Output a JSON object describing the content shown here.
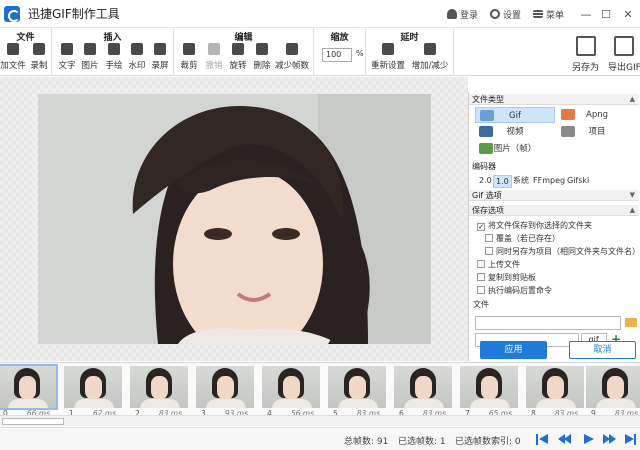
{
  "app": {
    "title": "迅捷GIF制作工具",
    "brand_color": "#1f7ad8"
  },
  "titlebar": {
    "login": "登录",
    "settings": "设置",
    "menu": "菜单",
    "minimize": "—",
    "maximize": "☐",
    "close": "✕"
  },
  "ribbon": {
    "file": {
      "title": "文件",
      "tools": [
        "加文件",
        "录制"
      ]
    },
    "insert": {
      "title": "插入",
      "tools": [
        "文字",
        "图片",
        "手绘",
        "水印",
        "录屏"
      ]
    },
    "edit": {
      "title": "编辑",
      "tools": [
        "裁剪",
        "撤销",
        "旋转",
        "删除",
        "减少帧数"
      ]
    },
    "zoom": {
      "title": "缩放",
      "value": "100",
      "unit": "%"
    },
    "delay": {
      "title": "延时",
      "tools": [
        "重新设置",
        "增加/减少"
      ]
    },
    "save_as": "另存为",
    "export_gif": "导出GIF"
  },
  "panel": {
    "file_type_header": "文件类型",
    "file_types": [
      {
        "label": "Gif",
        "selected": true
      },
      {
        "label": "Apng",
        "selected": false
      },
      {
        "label": "视频",
        "selected": false
      },
      {
        "label": "项目",
        "selected": false
      },
      {
        "label": "图片（帧）",
        "selected": false
      }
    ],
    "encoder_header": "编码器",
    "encoders": [
      {
        "label": "2.0",
        "selected": false
      },
      {
        "label": "1.0",
        "selected": true
      },
      {
        "label": "系统",
        "selected": false
      },
      {
        "label": "FFmpeg",
        "selected": false
      },
      {
        "label": "Gifski",
        "selected": false
      }
    ],
    "gif_options_header": "Gif 选项",
    "save_options_header": "保存选项",
    "options": [
      {
        "label": "将文件保存到你选择的文件夹",
        "checked": true
      },
      {
        "label": "覆盖（若已存在）",
        "checked": false
      },
      {
        "label": "同时另存为项目（相同文件夹与文件名）",
        "checked": false
      },
      {
        "label": "上传文件",
        "checked": false
      },
      {
        "label": "复制到剪贴板",
        "checked": false
      },
      {
        "label": "执行编码后置命令",
        "checked": false
      }
    ],
    "file_label": "文件",
    "extension": ".gif"
  },
  "actions": {
    "apply": "应用",
    "cancel": "取消"
  },
  "frames": [
    {
      "index": "0",
      "duration": "66 ms"
    },
    {
      "index": "1",
      "duration": "62 ms"
    },
    {
      "index": "2",
      "duration": "83 ms"
    },
    {
      "index": "3",
      "duration": "93 ms"
    },
    {
      "index": "4",
      "duration": "56 ms"
    },
    {
      "index": "5",
      "duration": "83 ms"
    },
    {
      "index": "6",
      "duration": "83 ms"
    },
    {
      "index": "7",
      "duration": "65 ms"
    },
    {
      "index": "8",
      "duration": "83 ms"
    },
    {
      "index": "9",
      "duration": "83 ms"
    }
  ],
  "status": {
    "total_frames": "总帧数: 91",
    "selected_frames": "已选帧数: 1",
    "selected_index": "已选帧数索引: 0"
  }
}
